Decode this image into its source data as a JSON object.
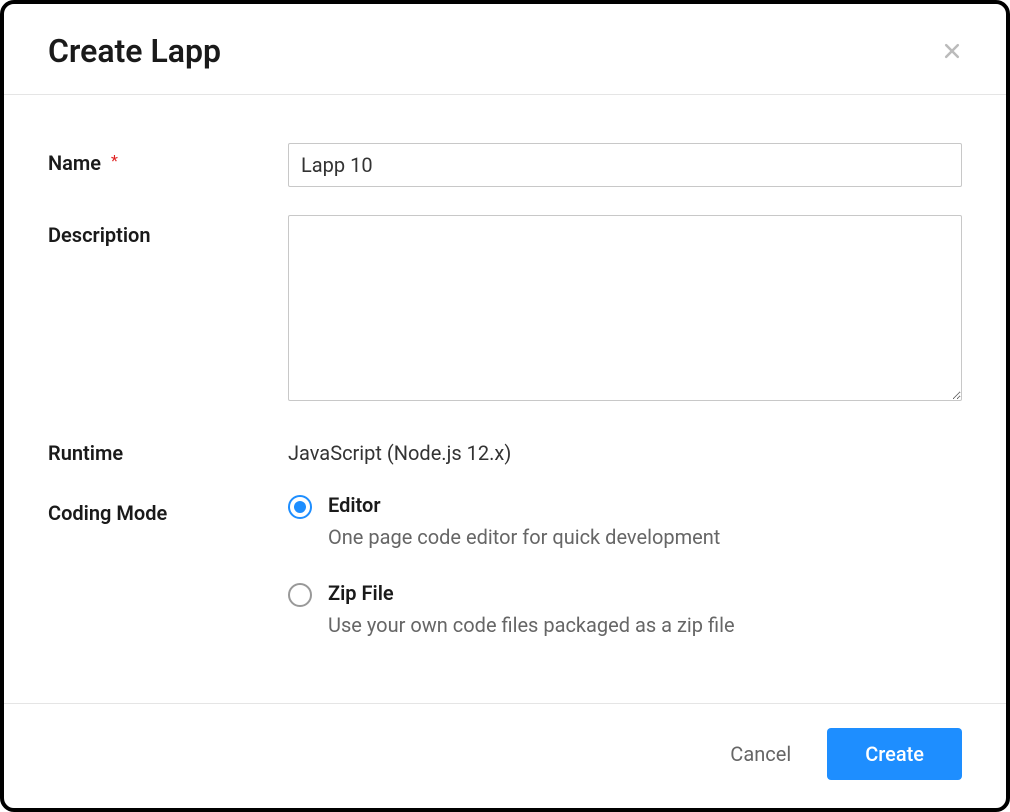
{
  "modal": {
    "title": "Create Lapp",
    "form": {
      "name": {
        "label": "Name",
        "required_mark": "*",
        "value": "Lapp 10"
      },
      "description": {
        "label": "Description",
        "value": ""
      },
      "runtime": {
        "label": "Runtime",
        "value": "JavaScript (Node.js 12.x)"
      },
      "coding_mode": {
        "label": "Coding Mode",
        "options": [
          {
            "label": "Editor",
            "description": "One page code editor for quick development",
            "selected": true
          },
          {
            "label": "Zip File",
            "description": "Use your own code files packaged as a zip file",
            "selected": false
          }
        ]
      }
    },
    "footer": {
      "cancel_label": "Cancel",
      "create_label": "Create"
    }
  }
}
